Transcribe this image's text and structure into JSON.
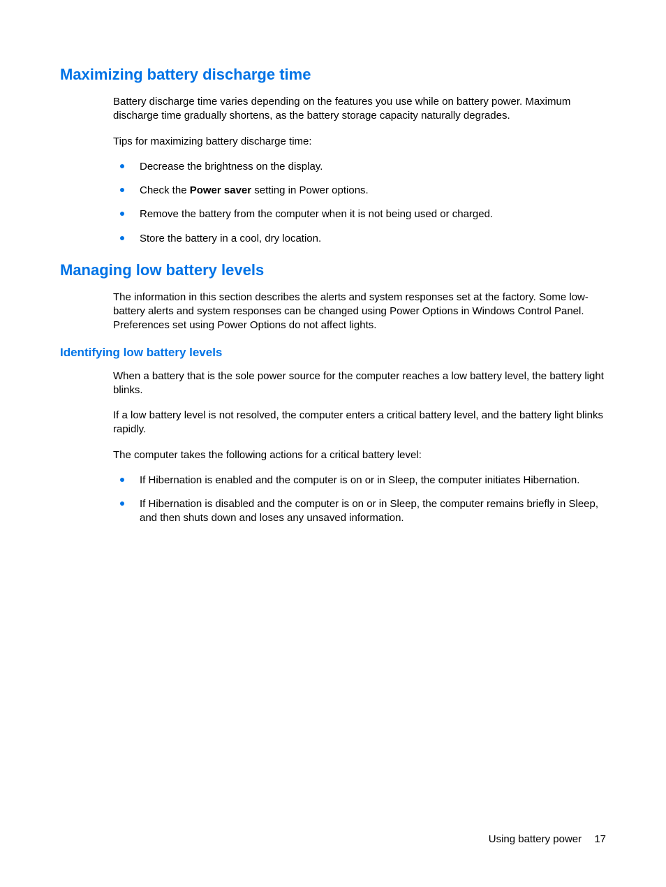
{
  "section1": {
    "heading": "Maximizing battery discharge time",
    "para1": "Battery discharge time varies depending on the features you use while on battery power. Maximum discharge time gradually shortens, as the battery storage capacity naturally degrades.",
    "tipsIntro": "Tips for maximizing battery discharge time:",
    "tips": [
      "Decrease the brightness on the display.",
      "Check the |Power saver| setting in Power options.",
      "Remove the battery from the computer when it is not being used or charged.",
      "Store the battery in a cool, dry location."
    ]
  },
  "section2": {
    "heading": "Managing low battery levels",
    "para1": "The information in this section describes the alerts and system responses set at the factory. Some low-battery alerts and system responses can be changed using Power Options in Windows Control Panel. Preferences set using Power Options do not affect lights.",
    "subsection": {
      "heading": "Identifying low battery levels",
      "para1": "When a battery that is the sole power source for the computer reaches a low battery level, the battery light blinks.",
      "para2": "If a low battery level is not resolved, the computer enters a critical battery level, and the battery light blinks rapidly.",
      "para3": "The computer takes the following actions for a critical battery level:",
      "actions": [
        "If Hibernation is enabled and the computer is on or in Sleep, the computer initiates Hibernation.",
        "If Hibernation is disabled and the computer is on or in Sleep, the computer remains briefly in Sleep, and then shuts down and loses any unsaved information."
      ]
    }
  },
  "footer": {
    "label": "Using battery power",
    "pageNumber": "17"
  }
}
